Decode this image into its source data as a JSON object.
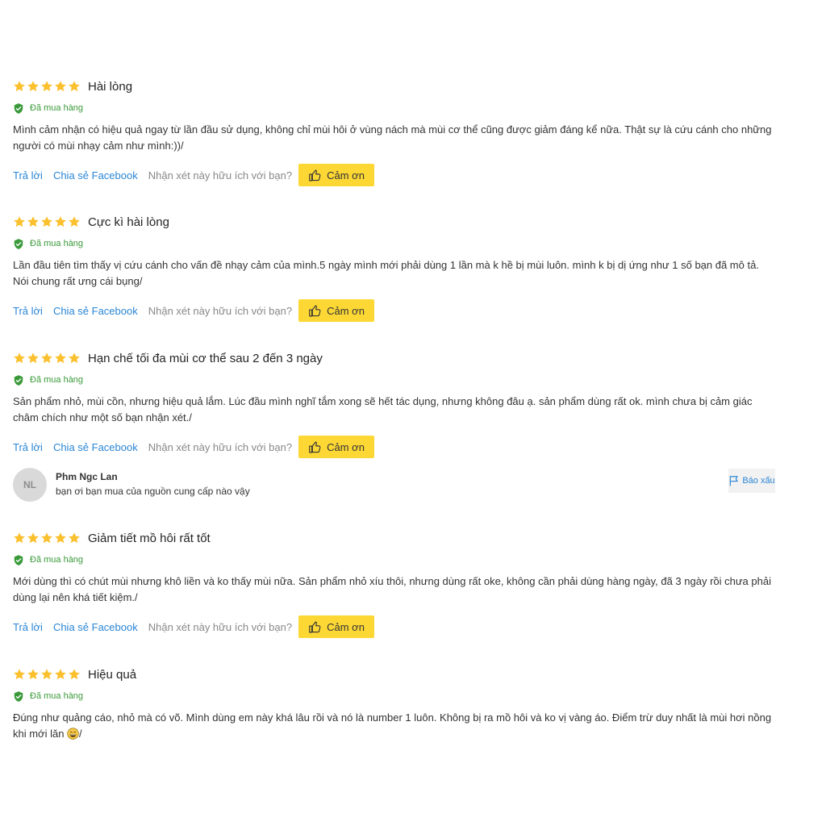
{
  "colors": {
    "star": "#fbc02d",
    "verified": "#3a9a3a",
    "link": "#2a86d6",
    "thanks_bg": "#fdd835"
  },
  "reviews": [
    {
      "rating": 5,
      "title": "Hài lòng",
      "verified": "Đã mua hàng",
      "line1": "Mình cảm nhận có hiệu quả ngay từ lần đầu sử dụng, không chỉ mùi hôi ở vùng nách mà mùi cơ thể cũng được giảm đáng kể nữa. Thật sự là cứu cánh cho những",
      "line2": "người có mùi nhạy cảm như mình:))/",
      "reply": "Trả lời",
      "share": "Chia sẻ Facebook",
      "question": "Nhận xét này hữu ích với bạn?",
      "thanks": "Cảm ơn"
    },
    {
      "rating": 5,
      "title": "Cực kì hài lòng",
      "verified": "Đã mua hàng",
      "line1": "Lần đầu tiên tìm thấy vị cứu cánh cho vấn đề nhạy cảm của mình.5 ngày mình mới phải dùng 1 lần mà k hề bị mùi luôn. mình k bị dị ứng như 1 số bạn đã mô tả.",
      "line2": "Nói chung rất ưng cái bụng/",
      "reply": "Trả lời",
      "share": "Chia sẻ Facebook",
      "question": "Nhận xét này hữu ích với bạn?",
      "thanks": "Cảm ơn"
    },
    {
      "rating": 5,
      "title": "Hạn chế tối đa mùi cơ thể sau 2 đến 3 ngày",
      "verified": "Đã mua hàng",
      "line1": "Sản phẩm nhỏ, mùi cồn, nhưng hiệu quả lắm. Lúc đầu mình nghĩ tắm xong sẽ hết tác dụng, nhưng không đâu ạ. sản phẩm dùng rất ok. mình chưa bị cảm giác",
      "line2": "châm chích như một số bạn nhận xét./",
      "reply": "Trả lời",
      "share": "Chia sẻ Facebook",
      "question": "Nhận xét này hữu ích với bạn?",
      "thanks": "Cảm ơn"
    },
    {
      "rating": 5,
      "title": "Giảm tiết mồ hôi rất tốt",
      "verified": "Đã mua hàng",
      "line1": "Mới dùng thì có chút mùi nhưng khô liền và ko thấy mùi nữa. Sản phẩm nhỏ xíu thôi, nhưng dùng rất oke, không cần phải dùng hàng ngày, đã 3 ngày rồi chưa phải",
      "line2": "dùng lại nên khá tiết kiệm./",
      "reply": "Trả lời",
      "share": "Chia sẻ Facebook",
      "question": "Nhận xét này hữu ích với bạn?",
      "thanks": "Cảm ơn"
    },
    {
      "rating": 5,
      "title": "Hiệu quả",
      "verified": "Đã mua hàng",
      "line1": "Đúng như quảng cáo, nhỏ mà có võ. Mình dùng em này khá lâu rồi và nó là number 1 luôn. Không bị ra mồ hôi và ko vị vàng áo. Điểm trừ duy nhất là mùi hơi nồng",
      "line2_before_emoji": "khi mới lăn ",
      "emoji": "grinning-face-icon",
      "line2_after_emoji": "/"
    }
  ],
  "comment": {
    "initials": "NL",
    "name": "Phm Ngc Lan",
    "text": "bạn ơi bạn mua của nguồn cung cấp nào vậy",
    "report": "Báo xấu",
    "report_icon": "flag-icon"
  }
}
